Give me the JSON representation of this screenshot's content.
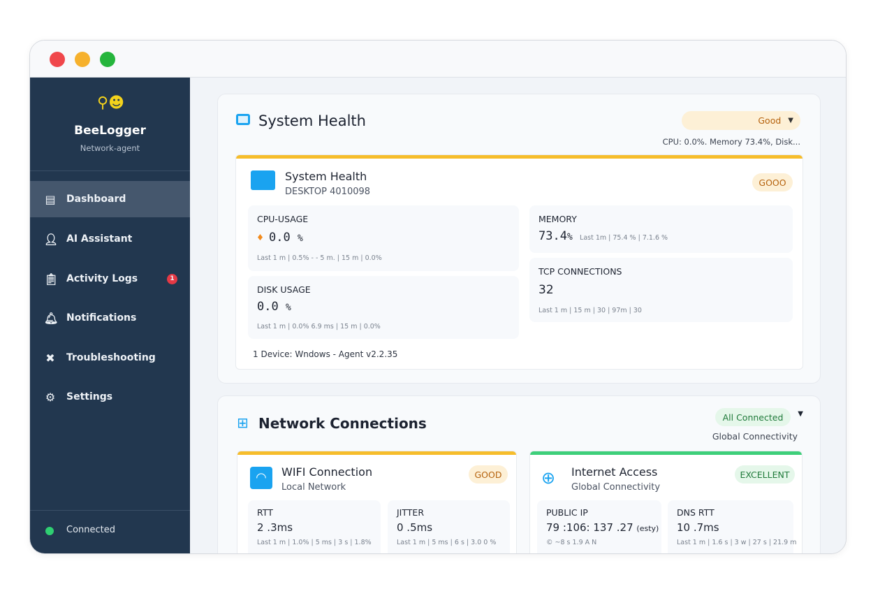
{
  "window": {
    "controls": [
      "close",
      "minimize",
      "maximize"
    ]
  },
  "sidebar": {
    "brand": "BeeLogger",
    "subtitle": "Network-agent",
    "items": [
      {
        "label": "Dashboard",
        "icon": "dashboard-icon"
      },
      {
        "label": "AI Assistant",
        "icon": "user-icon"
      },
      {
        "label": "Activity Logs",
        "icon": "clipboard-icon",
        "badge": "1"
      },
      {
        "label": "Notifications",
        "icon": "bell-icon"
      },
      {
        "label": "Troubleshooting",
        "icon": "tools-icon"
      },
      {
        "label": "Settings",
        "icon": "gear-icon"
      }
    ],
    "status": "Connected"
  },
  "system": {
    "title": "System Health",
    "status": "Good",
    "summary": "CPU: 0.0%. Memory 73.4%, Disk...",
    "card": {
      "title": "System Health",
      "host": "DESKTOP 4010098",
      "badge": "GOOO",
      "cpu": {
        "label": "CPU-USAGE",
        "value": "0.0",
        "unit": "%",
        "stats": "Last 1 m  |  0.5% - - 5 m.  |  15 m  |  0.0%"
      },
      "disk": {
        "label": "DISK USAGE",
        "value": "0.0",
        "unit": "%",
        "stats": "Last 1 m  |  0.0%  6.9 ms  |  15 m  |  0.0%"
      },
      "memory": {
        "label": "MEMORY",
        "value": "73.4",
        "unit": "%",
        "stats": "Last 1m  |  75.4 %  |  7.1.6 %"
      },
      "tcp": {
        "label": "TCP CONNECTIONS",
        "value": "32",
        "stats": "Last 1 m  |  15 m  |  30  |  97m  |  30"
      },
      "footer": "1 Device: Wndows - Agent v2.2.35"
    }
  },
  "network": {
    "title": "Network Connections",
    "status": "All Connected",
    "subtitle": "Global Connectivity",
    "wifi": {
      "title": "WIFI Connection",
      "subtitle": "Local Network",
      "badge": "GOOD",
      "rtt": {
        "label": "RTT",
        "value": "2 .3ms",
        "stats": "Last 1 m  |  1.0%  |  5 ms  |  3 s  |  1.8%"
      },
      "jitter": {
        "label": "JITTER",
        "value": "0 .5ms",
        "stats": "Last 1 m  |  5 ms  |  6 s  |  3.0 0 %"
      }
    },
    "internet": {
      "title": "Internet Access",
      "subtitle": "Global Connectivity",
      "badge": "EXCELLENT",
      "ip": {
        "label": "PUBLIC IP",
        "value": "79 :106: 137 .27",
        "note": "(esty)",
        "stats": "© ~8 s  1.9 A N"
      },
      "dns": {
        "label": "DNS RTT",
        "value": "10 .7ms",
        "stats": "Last 1 m  |  1.6 s  |  3 w  |  27 s  |  21.9 m"
      }
    }
  },
  "colors": {
    "sidebar": "#22374f",
    "accent_yellow": "#f6bd2b",
    "accent_green": "#3ecf7a",
    "icon_blue": "#1aa3f0"
  }
}
